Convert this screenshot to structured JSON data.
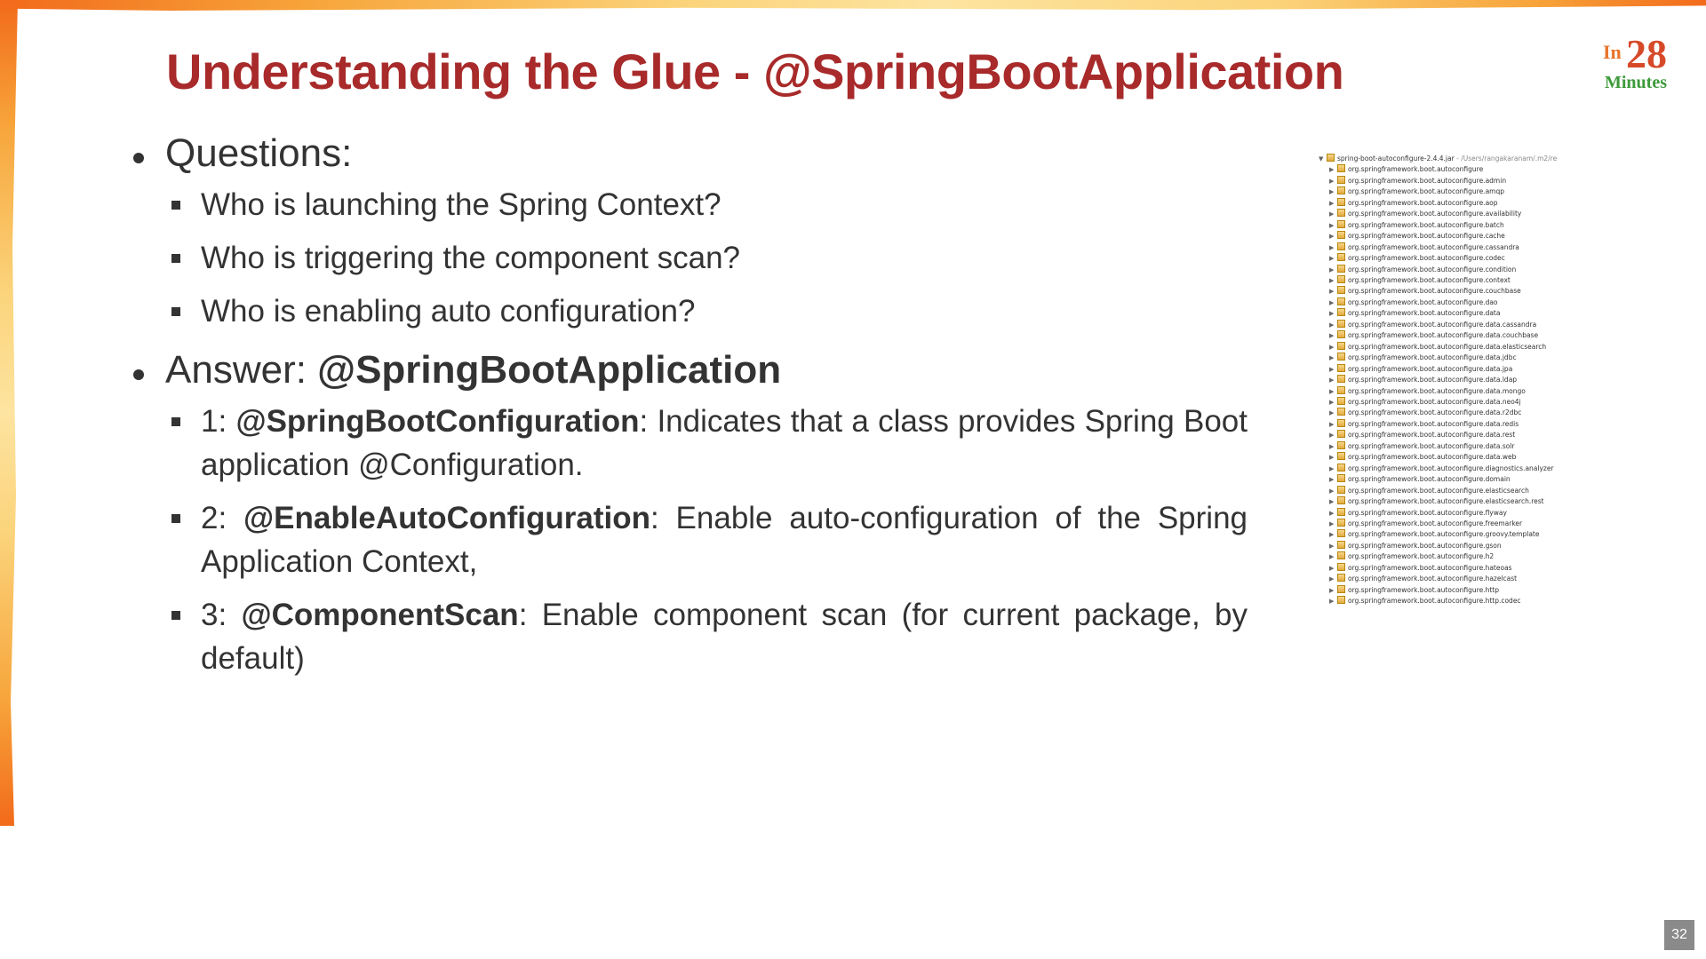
{
  "slide": {
    "title": "Understanding the Glue - @SpringBootApplication",
    "logo": {
      "in": "In",
      "number": "28",
      "word": "Minutes"
    },
    "questions": {
      "label": "Questions:",
      "items": [
        "Who is launching the Spring Context?",
        "Who is triggering the component scan?",
        "Who is enabling auto configuration?"
      ]
    },
    "answer": {
      "label": "Answer: ",
      "value": "@SpringBootApplication",
      "items": [
        {
          "prefix": "1: ",
          "name": "@SpringBootConfiguration",
          "desc": ": Indicates that a class provides Spring Boot application @Configuration."
        },
        {
          "prefix": "2: ",
          "name": "@EnableAutoConfiguration",
          "desc": ": Enable auto-configuration of the Spring Application Context,"
        },
        {
          "prefix": "3: ",
          "name": "@ComponentScan",
          "desc": ": Enable component scan (for current package, by default)"
        }
      ]
    },
    "page_number": "32"
  },
  "tree": {
    "root": "spring-boot-autoconfigure-2.4.4.jar",
    "root_path": " - /Users/rangakaranam/.m2/re",
    "packages": [
      "org.springframework.boot.autoconfigure",
      "org.springframework.boot.autoconfigure.admin",
      "org.springframework.boot.autoconfigure.amqp",
      "org.springframework.boot.autoconfigure.aop",
      "org.springframework.boot.autoconfigure.availability",
      "org.springframework.boot.autoconfigure.batch",
      "org.springframework.boot.autoconfigure.cache",
      "org.springframework.boot.autoconfigure.cassandra",
      "org.springframework.boot.autoconfigure.codec",
      "org.springframework.boot.autoconfigure.condition",
      "org.springframework.boot.autoconfigure.context",
      "org.springframework.boot.autoconfigure.couchbase",
      "org.springframework.boot.autoconfigure.dao",
      "org.springframework.boot.autoconfigure.data",
      "org.springframework.boot.autoconfigure.data.cassandra",
      "org.springframework.boot.autoconfigure.data.couchbase",
      "org.springframework.boot.autoconfigure.data.elasticsearch",
      "org.springframework.boot.autoconfigure.data.jdbc",
      "org.springframework.boot.autoconfigure.data.jpa",
      "org.springframework.boot.autoconfigure.data.ldap",
      "org.springframework.boot.autoconfigure.data.mongo",
      "org.springframework.boot.autoconfigure.data.neo4j",
      "org.springframework.boot.autoconfigure.data.r2dbc",
      "org.springframework.boot.autoconfigure.data.redis",
      "org.springframework.boot.autoconfigure.data.rest",
      "org.springframework.boot.autoconfigure.data.solr",
      "org.springframework.boot.autoconfigure.data.web",
      "org.springframework.boot.autoconfigure.diagnostics.analyzer",
      "org.springframework.boot.autoconfigure.domain",
      "org.springframework.boot.autoconfigure.elasticsearch",
      "org.springframework.boot.autoconfigure.elasticsearch.rest",
      "org.springframework.boot.autoconfigure.flyway",
      "org.springframework.boot.autoconfigure.freemarker",
      "org.springframework.boot.autoconfigure.groovy.template",
      "org.springframework.boot.autoconfigure.gson",
      "org.springframework.boot.autoconfigure.h2",
      "org.springframework.boot.autoconfigure.hateoas",
      "org.springframework.boot.autoconfigure.hazelcast",
      "org.springframework.boot.autoconfigure.http",
      "org.springframework.boot.autoconfigure.http.codec"
    ]
  }
}
